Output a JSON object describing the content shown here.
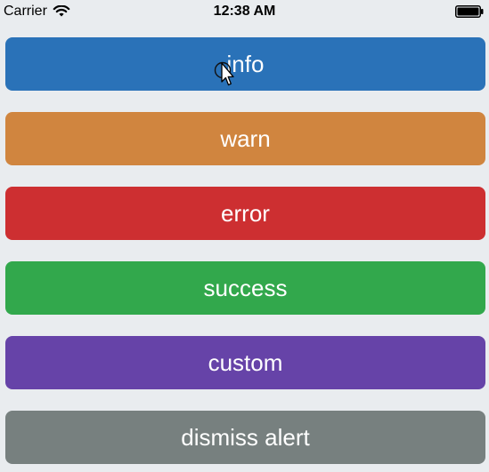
{
  "status_bar": {
    "carrier": "Carrier",
    "time": "12:38 AM",
    "wifi_icon": "wifi-icon",
    "battery_icon": "battery-icon"
  },
  "buttons": [
    {
      "label": "info",
      "color": "#2a72b8"
    },
    {
      "label": "warn",
      "color": "#d0853f"
    },
    {
      "label": "error",
      "color": "#cd2f31"
    },
    {
      "label": "success",
      "color": "#32a84c"
    },
    {
      "label": "custom",
      "color": "#6643a8"
    },
    {
      "label": "dismiss alert",
      "color": "#77807f"
    }
  ],
  "cursor": {
    "icon": "mouse-pointer-icon"
  }
}
